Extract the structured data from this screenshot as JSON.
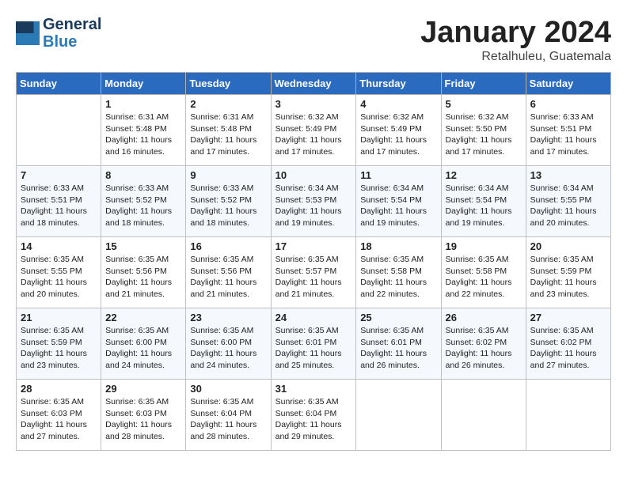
{
  "logo": {
    "line1": "General",
    "line2": "Blue"
  },
  "title": "January 2024",
  "subtitle": "Retalhuleu, Guatemala",
  "days_of_week": [
    "Sunday",
    "Monday",
    "Tuesday",
    "Wednesday",
    "Thursday",
    "Friday",
    "Saturday"
  ],
  "weeks": [
    [
      {
        "day": "",
        "info": ""
      },
      {
        "day": "1",
        "info": "Sunrise: 6:31 AM\nSunset: 5:48 PM\nDaylight: 11 hours\nand 16 minutes."
      },
      {
        "day": "2",
        "info": "Sunrise: 6:31 AM\nSunset: 5:48 PM\nDaylight: 11 hours\nand 17 minutes."
      },
      {
        "day": "3",
        "info": "Sunrise: 6:32 AM\nSunset: 5:49 PM\nDaylight: 11 hours\nand 17 minutes."
      },
      {
        "day": "4",
        "info": "Sunrise: 6:32 AM\nSunset: 5:49 PM\nDaylight: 11 hours\nand 17 minutes."
      },
      {
        "day": "5",
        "info": "Sunrise: 6:32 AM\nSunset: 5:50 PM\nDaylight: 11 hours\nand 17 minutes."
      },
      {
        "day": "6",
        "info": "Sunrise: 6:33 AM\nSunset: 5:51 PM\nDaylight: 11 hours\nand 17 minutes."
      }
    ],
    [
      {
        "day": "7",
        "info": "Sunrise: 6:33 AM\nSunset: 5:51 PM\nDaylight: 11 hours\nand 18 minutes."
      },
      {
        "day": "8",
        "info": "Sunrise: 6:33 AM\nSunset: 5:52 PM\nDaylight: 11 hours\nand 18 minutes."
      },
      {
        "day": "9",
        "info": "Sunrise: 6:33 AM\nSunset: 5:52 PM\nDaylight: 11 hours\nand 18 minutes."
      },
      {
        "day": "10",
        "info": "Sunrise: 6:34 AM\nSunset: 5:53 PM\nDaylight: 11 hours\nand 19 minutes."
      },
      {
        "day": "11",
        "info": "Sunrise: 6:34 AM\nSunset: 5:54 PM\nDaylight: 11 hours\nand 19 minutes."
      },
      {
        "day": "12",
        "info": "Sunrise: 6:34 AM\nSunset: 5:54 PM\nDaylight: 11 hours\nand 19 minutes."
      },
      {
        "day": "13",
        "info": "Sunrise: 6:34 AM\nSunset: 5:55 PM\nDaylight: 11 hours\nand 20 minutes."
      }
    ],
    [
      {
        "day": "14",
        "info": "Sunrise: 6:35 AM\nSunset: 5:55 PM\nDaylight: 11 hours\nand 20 minutes."
      },
      {
        "day": "15",
        "info": "Sunrise: 6:35 AM\nSunset: 5:56 PM\nDaylight: 11 hours\nand 21 minutes."
      },
      {
        "day": "16",
        "info": "Sunrise: 6:35 AM\nSunset: 5:56 PM\nDaylight: 11 hours\nand 21 minutes."
      },
      {
        "day": "17",
        "info": "Sunrise: 6:35 AM\nSunset: 5:57 PM\nDaylight: 11 hours\nand 21 minutes."
      },
      {
        "day": "18",
        "info": "Sunrise: 6:35 AM\nSunset: 5:58 PM\nDaylight: 11 hours\nand 22 minutes."
      },
      {
        "day": "19",
        "info": "Sunrise: 6:35 AM\nSunset: 5:58 PM\nDaylight: 11 hours\nand 22 minutes."
      },
      {
        "day": "20",
        "info": "Sunrise: 6:35 AM\nSunset: 5:59 PM\nDaylight: 11 hours\nand 23 minutes."
      }
    ],
    [
      {
        "day": "21",
        "info": "Sunrise: 6:35 AM\nSunset: 5:59 PM\nDaylight: 11 hours\nand 23 minutes."
      },
      {
        "day": "22",
        "info": "Sunrise: 6:35 AM\nSunset: 6:00 PM\nDaylight: 11 hours\nand 24 minutes."
      },
      {
        "day": "23",
        "info": "Sunrise: 6:35 AM\nSunset: 6:00 PM\nDaylight: 11 hours\nand 24 minutes."
      },
      {
        "day": "24",
        "info": "Sunrise: 6:35 AM\nSunset: 6:01 PM\nDaylight: 11 hours\nand 25 minutes."
      },
      {
        "day": "25",
        "info": "Sunrise: 6:35 AM\nSunset: 6:01 PM\nDaylight: 11 hours\nand 26 minutes."
      },
      {
        "day": "26",
        "info": "Sunrise: 6:35 AM\nSunset: 6:02 PM\nDaylight: 11 hours\nand 26 minutes."
      },
      {
        "day": "27",
        "info": "Sunrise: 6:35 AM\nSunset: 6:02 PM\nDaylight: 11 hours\nand 27 minutes."
      }
    ],
    [
      {
        "day": "28",
        "info": "Sunrise: 6:35 AM\nSunset: 6:03 PM\nDaylight: 11 hours\nand 27 minutes."
      },
      {
        "day": "29",
        "info": "Sunrise: 6:35 AM\nSunset: 6:03 PM\nDaylight: 11 hours\nand 28 minutes."
      },
      {
        "day": "30",
        "info": "Sunrise: 6:35 AM\nSunset: 6:04 PM\nDaylight: 11 hours\nand 28 minutes."
      },
      {
        "day": "31",
        "info": "Sunrise: 6:35 AM\nSunset: 6:04 PM\nDaylight: 11 hours\nand 29 minutes."
      },
      {
        "day": "",
        "info": ""
      },
      {
        "day": "",
        "info": ""
      },
      {
        "day": "",
        "info": ""
      }
    ]
  ]
}
